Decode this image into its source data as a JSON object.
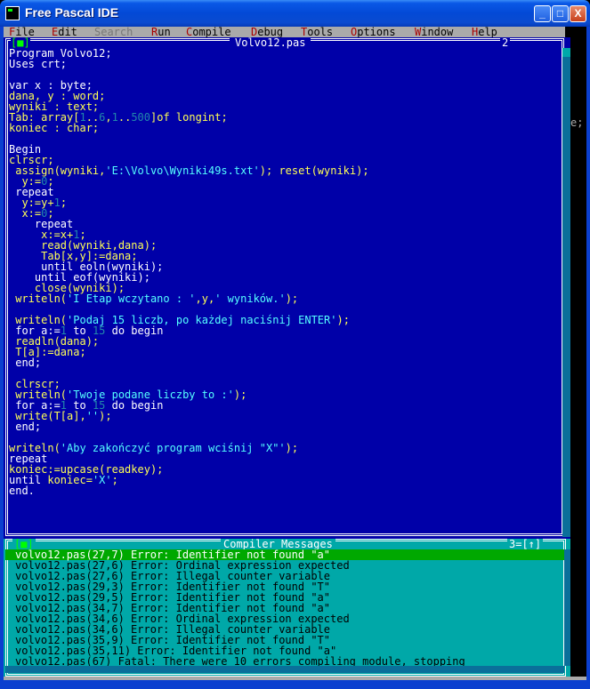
{
  "window": {
    "title": "Free Pascal IDE",
    "minimize": "_",
    "maximize": "□",
    "close": "X"
  },
  "menu": [
    {
      "hot": "F",
      "rest": "ile"
    },
    {
      "hot": "E",
      "rest": "dit"
    },
    {
      "hot": "",
      "rest": "Search",
      "disabled": true
    },
    {
      "hot": "R",
      "rest": "un"
    },
    {
      "hot": "C",
      "rest": "ompile"
    },
    {
      "hot": "D",
      "rest": "ebug"
    },
    {
      "hot": "T",
      "rest": "ools"
    },
    {
      "hot": "O",
      "rest": "ptions"
    },
    {
      "hot": "W",
      "rest": "indow"
    },
    {
      "hot": "H",
      "rest": "elp"
    }
  ],
  "editor": {
    "close_glyph": "[■]",
    "title": "Volvo12.pas",
    "window_number": "2",
    "lines": [
      [
        [
          "k",
          "Program Volvo12;"
        ]
      ],
      [
        [
          "k",
          "Uses crt;"
        ]
      ],
      [
        [
          "k",
          ""
        ]
      ],
      [
        [
          "k",
          "var x : byte;"
        ]
      ],
      [
        [
          "y",
          "dana, y : word;"
        ]
      ],
      [
        [
          "y",
          "wyniki : text;"
        ]
      ],
      [
        [
          "y",
          "Tab: array["
        ],
        [
          "n",
          "1"
        ],
        [
          "y",
          ".."
        ],
        [
          "n",
          "6"
        ],
        [
          "y",
          ","
        ],
        [
          "n",
          "1"
        ],
        [
          "y",
          ".."
        ],
        [
          "n",
          "500"
        ],
        [
          "y",
          "]of longint;"
        ]
      ],
      [
        [
          "y",
          "koniec : char;"
        ]
      ],
      [
        [
          "k",
          ""
        ]
      ],
      [
        [
          "k",
          "Begin"
        ]
      ],
      [
        [
          "y",
          "clrscr;"
        ]
      ],
      [
        [
          "y",
          " assign(wyniki,"
        ],
        [
          "c",
          "'E:\\Volvo\\Wyniki49s.txt'"
        ],
        [
          "y",
          "); reset(wyniki);"
        ]
      ],
      [
        [
          "y",
          "  y:="
        ],
        [
          "n",
          "0"
        ],
        [
          "y",
          ";"
        ]
      ],
      [
        [
          "k",
          " repeat"
        ]
      ],
      [
        [
          "y",
          "  y:=y+"
        ],
        [
          "n",
          "1"
        ],
        [
          "y",
          ";"
        ]
      ],
      [
        [
          "y",
          "  x:="
        ],
        [
          "n",
          "0"
        ],
        [
          "y",
          ";"
        ]
      ],
      [
        [
          "k",
          "    repeat"
        ]
      ],
      [
        [
          "y",
          "     x:=x+"
        ],
        [
          "n",
          "1"
        ],
        [
          "y",
          ";"
        ]
      ],
      [
        [
          "y",
          "     read(wyniki,dana);"
        ]
      ],
      [
        [
          "y",
          "     Tab[x,y]:=dana;"
        ]
      ],
      [
        [
          "k",
          "     until eoln(wyniki);"
        ]
      ],
      [
        [
          "k",
          "    until eof(wyniki);"
        ]
      ],
      [
        [
          "y",
          "    close(wyniki);"
        ]
      ],
      [
        [
          "y",
          " writeln("
        ],
        [
          "c",
          "'I Etap wczytano : '"
        ],
        [
          "y",
          ",y,"
        ],
        [
          "c",
          "' wyników.'"
        ],
        [
          "y",
          ");"
        ]
      ],
      [
        [
          "k",
          ""
        ]
      ],
      [
        [
          "y",
          " writeln("
        ],
        [
          "c",
          "'Podaj 15 liczb, po każdej naciśnij ENTER'"
        ],
        [
          "y",
          ");"
        ]
      ],
      [
        [
          "k",
          " for a:="
        ],
        [
          "n",
          "1"
        ],
        [
          "k",
          " to "
        ],
        [
          "n",
          "15"
        ],
        [
          "k",
          " do begin"
        ]
      ],
      [
        [
          "y",
          " readln(dana);"
        ]
      ],
      [
        [
          "y",
          " T[a]:=dana;"
        ]
      ],
      [
        [
          "k",
          " end;"
        ]
      ],
      [
        [
          "k",
          ""
        ]
      ],
      [
        [
          "y",
          " clrscr;"
        ]
      ],
      [
        [
          "y",
          " writeln("
        ],
        [
          "c",
          "'Twoje podane liczby to :'"
        ],
        [
          "y",
          ");"
        ]
      ],
      [
        [
          "k",
          " for a:="
        ],
        [
          "n",
          "1"
        ],
        [
          "k",
          " to "
        ],
        [
          "n",
          "15"
        ],
        [
          "k",
          " do begin"
        ]
      ],
      [
        [
          "y",
          " write(T[a],"
        ],
        [
          "c",
          "''"
        ],
        [
          "y",
          ");"
        ]
      ],
      [
        [
          "k",
          " end;"
        ]
      ],
      [
        [
          "k",
          ""
        ]
      ],
      [
        [
          "y",
          "writeln("
        ],
        [
          "c",
          "'Aby zakończyć program wciśnij \"X\"'"
        ],
        [
          "y",
          ");"
        ]
      ],
      [
        [
          "k",
          "repeat"
        ]
      ],
      [
        [
          "y",
          "koniec:=upcase(readkey);"
        ]
      ],
      [
        [
          "k",
          "until "
        ],
        [
          "y",
          "koniec="
        ],
        [
          "c",
          "'X'"
        ],
        [
          "y",
          ";"
        ]
      ],
      [
        [
          "k",
          "end."
        ]
      ]
    ]
  },
  "right_strip_text": "e;",
  "messages": {
    "left_glyph": "[■]",
    "title": "Compiler Messages",
    "right_glyph": "3=[↑]",
    "items": [
      "volvo12.pas(27,7) Error: Identifier not found \"a\"",
      "volvo12.pas(27,6) Error: Ordinal expression expected",
      "volvo12.pas(27,6) Error: Illegal counter variable",
      "volvo12.pas(29,3) Error: Identifier not found \"T\"",
      "volvo12.pas(29,5) Error: Identifier not found \"a\"",
      "volvo12.pas(34,7) Error: Identifier not found \"a\"",
      "volvo12.pas(34,6) Error: Ordinal expression expected",
      "volvo12.pas(34,6) Error: Illegal counter variable",
      "volvo12.pas(35,9) Error: Identifier not found \"T\"",
      "volvo12.pas(35,11) Error: Identifier not found \"a\"",
      "volvo12.pas(67) Fatal: There were 10 errors compiling module, stopping"
    ],
    "selected_index": 0
  }
}
